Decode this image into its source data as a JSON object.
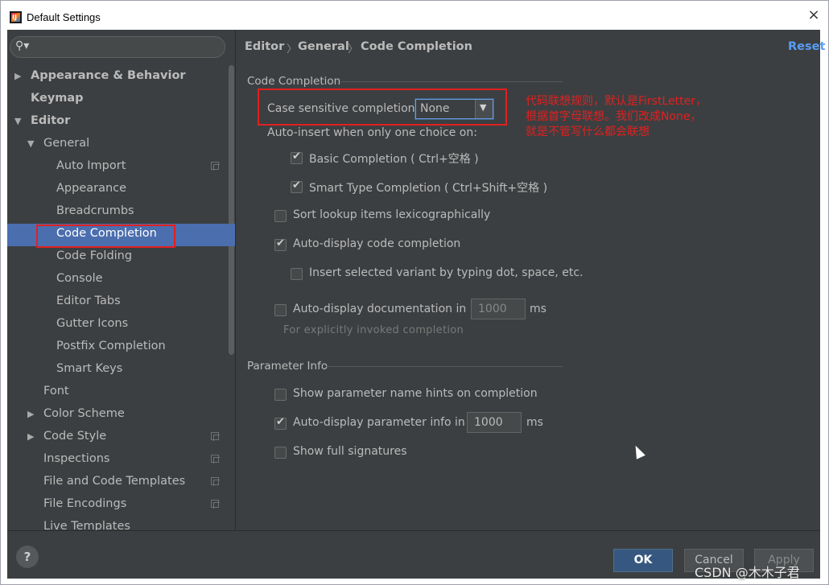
{
  "window": {
    "title": "Default Settings",
    "close": "×"
  },
  "search": {
    "icon": "search-icon"
  },
  "tree": {
    "appearance_behavior": "Appearance & Behavior",
    "keymap": "Keymap",
    "editor": "Editor",
    "general": "General",
    "auto_import": "Auto Import",
    "appearance": "Appearance",
    "breadcrumbs": "Breadcrumbs",
    "code_completion": "Code Completion",
    "code_folding": "Code Folding",
    "console": "Console",
    "editor_tabs": "Editor Tabs",
    "gutter_icons": "Gutter Icons",
    "postfix_completion": "Postfix Completion",
    "smart_keys": "Smart Keys",
    "font": "Font",
    "color_scheme": "Color Scheme",
    "code_style": "Code Style",
    "inspections": "Inspections",
    "file_code_templates": "File and Code Templates",
    "file_encodings": "File Encodings",
    "live_templates": "Live Templates"
  },
  "breadcrumb": {
    "a": "Editor",
    "b": "General",
    "c": "Code Completion",
    "sep": "〉"
  },
  "reset": "Reset",
  "code_completion": {
    "section": "Code Completion",
    "case_label": "Case sensitive completion:",
    "case_value": "None",
    "auto_insert": "Auto-insert when only one choice on:",
    "basic": "Basic Completion ( Ctrl+空格 )",
    "smart": "Smart Type Completion ( Ctrl+Shift+空格 )",
    "sort_lex": "Sort lookup items lexicographically",
    "auto_display": "Auto-display code completion",
    "insert_variant": "Insert selected variant by typing dot, space, etc.",
    "auto_doc": "Auto-display documentation in",
    "auto_doc_value": "1000",
    "ms": "ms",
    "hint": "For explicitly invoked completion"
  },
  "param_info": {
    "section": "Parameter Info",
    "show_hints": "Show parameter name hints on completion",
    "auto_param": "Auto-display parameter info in",
    "auto_param_value": "1000",
    "ms": "ms",
    "full_sig": "Show full signatures"
  },
  "annotation": "代码联想规则，默认是FirstLetter，根据首字母联想。我们改成None，就是不管写什么都会联想",
  "buttons": {
    "help": "?",
    "ok": "OK",
    "cancel": "Cancel",
    "apply": "Apply"
  },
  "watermark": "CSDN @木木子君"
}
